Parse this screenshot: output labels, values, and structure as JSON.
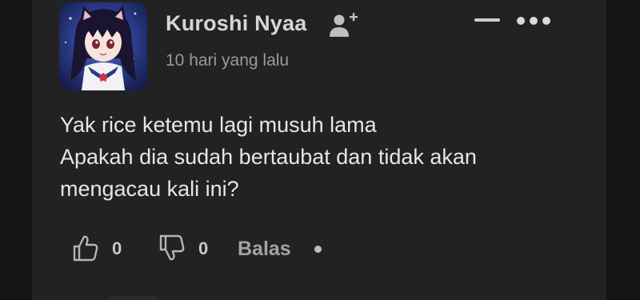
{
  "comment": {
    "author": "Kuroshi Nyaa",
    "timestamp": "10 hari yang lalu",
    "lines": [
      "Yak rice ketemu lagi musuh lama",
      "Apakah dia sudah bertaubat dan tidak akan",
      "mengacau kali ini?"
    ]
  },
  "actions": {
    "like_count": "0",
    "dislike_count": "0",
    "reply_label": "Balas"
  },
  "icons": {
    "follow": "add-user-icon",
    "collapse": "minus-icon",
    "more": "more-options-icon",
    "like": "thumbs-up-icon",
    "dislike": "thumbs-down-icon"
  },
  "colors": {
    "background": "#1b1b1d",
    "card": "#222224",
    "author": "#d6d6d6",
    "timestamp": "#9a9a9a",
    "body_text": "#e6e6e6"
  }
}
